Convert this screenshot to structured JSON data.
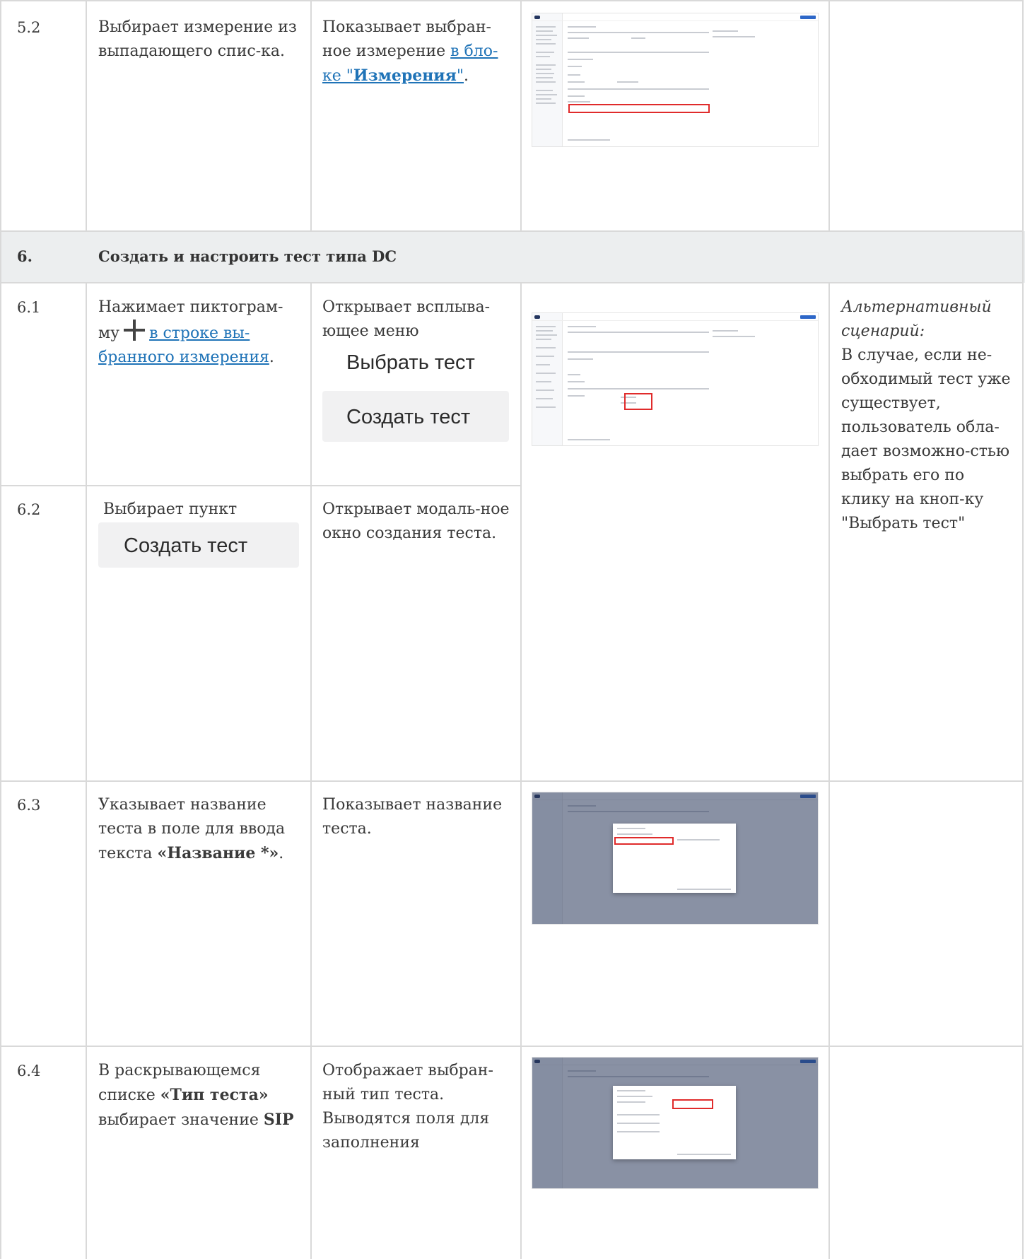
{
  "rows": {
    "r52": {
      "num": "5.2",
      "action": "Выбирает измерение из выпадающего спис-ка.",
      "result_text": "Показывает выбран-ное измерение",
      "result_link_pre": "в бло-ке \"",
      "result_link_bold": "Измерения",
      "result_link_post": "\"",
      "result_tail": "."
    },
    "section": {
      "num": "6.",
      "title": "Создать и настроить тест типа DC"
    },
    "r61": {
      "num": "6.1",
      "action_pre": "Нажимает пиктограм-му",
      "action_link": "в строке вы-бранного измерения",
      "action_tail": ".",
      "result_text": "Открывает всплыва-ющее меню",
      "menu_item_1": "Выбрать тест",
      "menu_item_2": "Создать тест",
      "note_italic": "Альтернативный сценарий:",
      "note_text": "В случае, если не-обходимый тест уже существует, пользователь обла-дает возможно-стью выбрать его по клику на кноп-ку \"Выбрать тест\""
    },
    "r62": {
      "num": "6.2",
      "action": "Выбирает пункт",
      "action_button": "Создать тест",
      "result_text": "Открывает модаль-ное окно создания теста."
    },
    "r63": {
      "num": "6.3",
      "action_pre": "Указывает название теста в поле для ввода текста ",
      "action_bold": "«Название *»",
      "action_tail": ".",
      "result_text": "Показывает название теста."
    },
    "r64": {
      "num": "6.4",
      "action_pre": "В раскрывающемся списке ",
      "action_bold": "«Тип теста»",
      "action_mid": " выбирает значение ",
      "action_value": "SIP",
      "result_text": "Отображает выбран-ный тип теста. Выводятся поля для заполнения"
    }
  }
}
